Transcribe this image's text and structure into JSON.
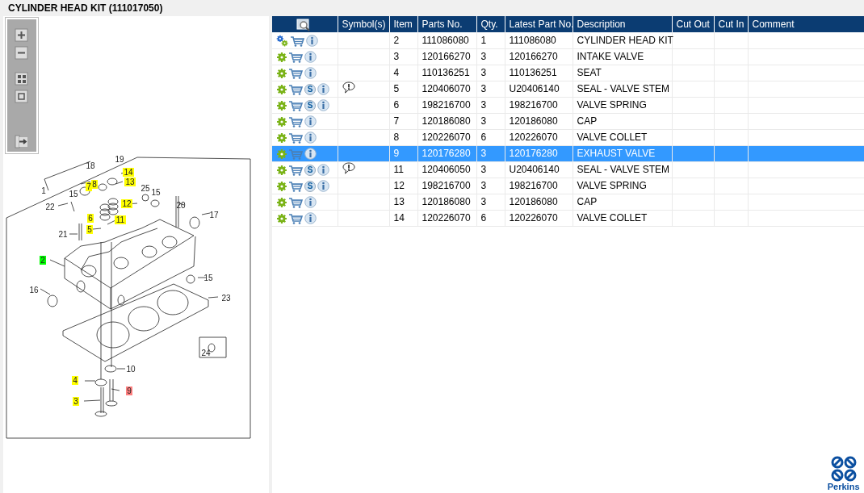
{
  "title": "CYLINDER HEAD KIT (111017050)",
  "diagram": {
    "callouts": [
      {
        "label": "1"
      },
      {
        "label": "18"
      },
      {
        "label": "19"
      },
      {
        "label": "14",
        "color": "#ffff00"
      },
      {
        "label": "13",
        "color": "#ffff00"
      },
      {
        "label": "7",
        "color": "#ffff00"
      },
      {
        "label": "8",
        "color": "#ffff00"
      },
      {
        "label": "15"
      },
      {
        "label": "25"
      },
      {
        "label": "15"
      },
      {
        "label": "22"
      },
      {
        "label": "12",
        "color": "#ffff00"
      },
      {
        "label": "6",
        "color": "#ffff00"
      },
      {
        "label": "11",
        "color": "#ffff00"
      },
      {
        "label": "20"
      },
      {
        "label": "17"
      },
      {
        "label": "5",
        "color": "#ffff00"
      },
      {
        "label": "21"
      },
      {
        "label": "2",
        "color": "#00ff00"
      },
      {
        "label": "16"
      },
      {
        "label": "15"
      },
      {
        "label": "23"
      },
      {
        "label": "24"
      },
      {
        "label": "10"
      },
      {
        "label": "4",
        "color": "#ffff00"
      },
      {
        "label": "9",
        "color": "#ff8080"
      },
      {
        "label": "3",
        "color": "#ffff00"
      }
    ]
  },
  "table": {
    "columns": [
      "Symbol(s)",
      "Item",
      "Parts No.",
      "Qty.",
      "Latest Part No.",
      "Description",
      "Cut Out",
      "Cut In",
      "Comment"
    ],
    "rows": [
      {
        "kind": "assembly",
        "note": false,
        "selected": false,
        "item": "2",
        "part_no": "111086080",
        "qty": "1",
        "latest": "111086080",
        "description": "CYLINDER HEAD KIT"
      },
      {
        "kind": "part",
        "note": false,
        "selected": false,
        "item": "3",
        "part_no": "120166270",
        "qty": "3",
        "latest": "120166270",
        "description": "INTAKE VALVE"
      },
      {
        "kind": "part",
        "note": false,
        "selected": false,
        "item": "4",
        "part_no": "110136251",
        "qty": "3",
        "latest": "110136251",
        "description": "SEAT"
      },
      {
        "kind": "part",
        "s_mark": "S",
        "note": true,
        "selected": false,
        "item": "5",
        "part_no": "120406070",
        "qty": "3",
        "latest": "U20406140",
        "description": "SEAL - VALVE STEM"
      },
      {
        "kind": "part",
        "s_mark": "S",
        "note": false,
        "selected": false,
        "item": "6",
        "part_no": "198216700",
        "qty": "3",
        "latest": "198216700",
        "description": "VALVE SPRING"
      },
      {
        "kind": "part",
        "note": false,
        "selected": false,
        "item": "7",
        "part_no": "120186080",
        "qty": "3",
        "latest": "120186080",
        "description": "CAP"
      },
      {
        "kind": "part",
        "note": false,
        "selected": false,
        "item": "8",
        "part_no": "120226070",
        "qty": "6",
        "latest": "120226070",
        "description": "VALVE COLLET"
      },
      {
        "kind": "part",
        "note": false,
        "selected": true,
        "item": "9",
        "part_no": "120176280",
        "qty": "3",
        "latest": "120176280",
        "description": "EXHAUST VALVE"
      },
      {
        "kind": "part",
        "s_mark": "S",
        "note": true,
        "selected": false,
        "item": "11",
        "part_no": "120406050",
        "qty": "3",
        "latest": "U20406140",
        "description": "SEAL - VALVE STEM"
      },
      {
        "kind": "part",
        "s_mark": "S",
        "note": false,
        "selected": false,
        "item": "12",
        "part_no": "198216700",
        "qty": "3",
        "latest": "198216700",
        "description": "VALVE SPRING"
      },
      {
        "kind": "part",
        "note": false,
        "selected": false,
        "item": "13",
        "part_no": "120186080",
        "qty": "3",
        "latest": "120186080",
        "description": "CAP"
      },
      {
        "kind": "part",
        "note": false,
        "selected": false,
        "item": "14",
        "part_no": "120226070",
        "qty": "6",
        "latest": "120226070",
        "description": "VALVE COLLET"
      }
    ]
  },
  "brand": {
    "name": "Perkins"
  }
}
